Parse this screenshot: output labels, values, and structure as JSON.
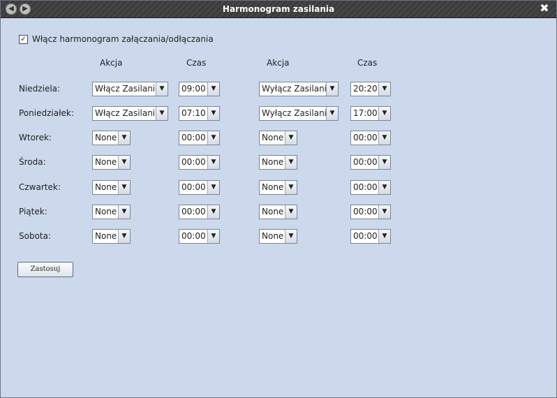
{
  "window": {
    "title": "Harmonogram zasilania",
    "back_icon": "◀",
    "forward_icon": "▶",
    "close_icon": "✖"
  },
  "enable": {
    "checked": true,
    "check_glyph": "✓",
    "label": "Włącz harmonogram załączania/odłączania"
  },
  "columns": [
    "Akcja",
    "Czas",
    "Akcja",
    "Czas"
  ],
  "days": [
    {
      "label": "Niedziela:",
      "action1": "Włącz Zasilanie",
      "time1": "09:00",
      "action2": "Wyłącz Zasilanie",
      "time2": "20:20"
    },
    {
      "label": "Poniedziałek:",
      "action1": "Włącz Zasilanie",
      "time1": "07:10",
      "action2": "Wyłącz Zasilanie",
      "time2": "17:00"
    },
    {
      "label": "Wtorek:",
      "action1": "None",
      "time1": "00:00",
      "action2": "None",
      "time2": "00:00"
    },
    {
      "label": "Środa:",
      "action1": "None",
      "time1": "00:00",
      "action2": "None",
      "time2": "00:00"
    },
    {
      "label": "Czwartek:",
      "action1": "None",
      "time1": "00:00",
      "action2": "None",
      "time2": "00:00"
    },
    {
      "label": "Piątek:",
      "action1": "None",
      "time1": "00:00",
      "action2": "None",
      "time2": "00:00"
    },
    {
      "label": "Sobota:",
      "action1": "None",
      "time1": "00:00",
      "action2": "None",
      "time2": "00:00"
    }
  ],
  "dropdown_icon": "▼",
  "apply_label": "Zastosuj"
}
